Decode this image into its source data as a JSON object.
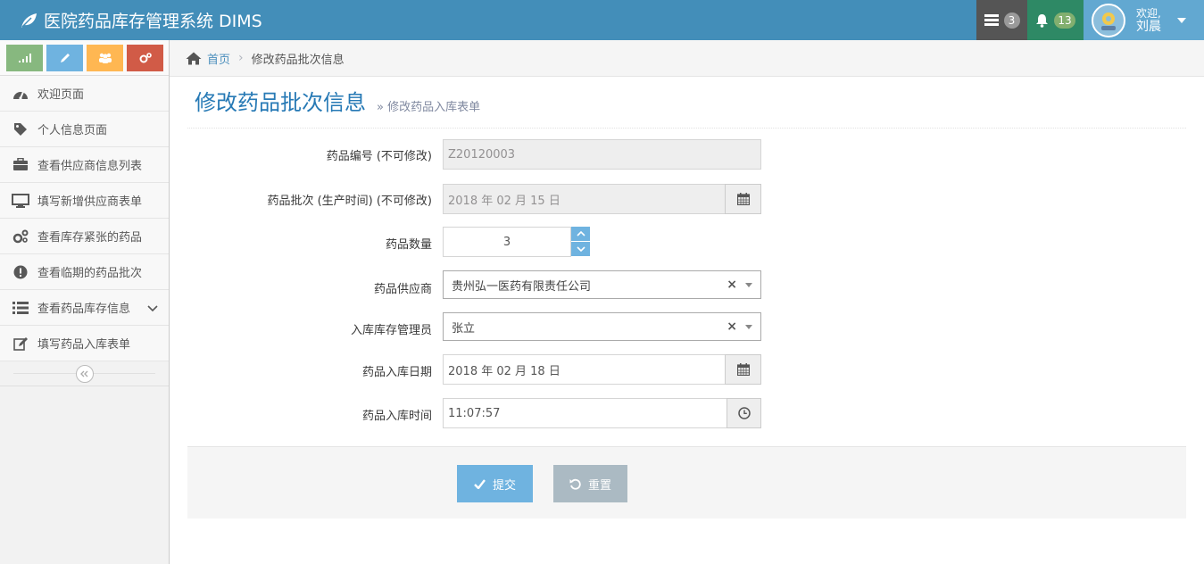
{
  "app": {
    "title": "医院药品库存管理系统 DIMS"
  },
  "navbar": {
    "tasks_count": "3",
    "notifications_count": "13",
    "user": {
      "greeting": "欢迎,",
      "name": "刘晨"
    }
  },
  "sidebar": {
    "shortcuts": [
      {
        "icon": "signal-icon",
        "color": "#87b87f"
      },
      {
        "icon": "pencil-icon",
        "color": "#6fb3e0"
      },
      {
        "icon": "users-icon",
        "color": "#ffb752"
      },
      {
        "icon": "cogs-icon",
        "color": "#d15b47"
      }
    ],
    "items": [
      {
        "label": "欢迎页面",
        "icon": "dashboard-icon"
      },
      {
        "label": "个人信息页面",
        "icon": "tag-icon"
      },
      {
        "label": "查看供应商信息列表",
        "icon": "briefcase-icon"
      },
      {
        "label": "填写新增供应商表单",
        "icon": "desktop-icon"
      },
      {
        "label": "查看库存紧张的药品",
        "icon": "cogs-icon"
      },
      {
        "label": "查看临期的药品批次",
        "icon": "exclamation-circle-icon"
      },
      {
        "label": "查看药品库存信息",
        "icon": "list-icon"
      },
      {
        "label": "填写药品入库表单",
        "icon": "edit-icon"
      }
    ]
  },
  "breadcrumb": {
    "home": "首页",
    "current": "修改药品批次信息"
  },
  "page": {
    "title": "修改药品批次信息",
    "subtitle": "修改药品入库表单"
  },
  "form": {
    "drug_id": {
      "label": "药品编号 (不可修改)",
      "value": "Z20120003"
    },
    "batch": {
      "label": "药品批次 (生产时间) (不可修改)",
      "value": "2018 年 02 月 15 日"
    },
    "quantity": {
      "label": "药品数量",
      "value": "3"
    },
    "supplier": {
      "label": "药品供应商",
      "value": "贵州弘一医药有限责任公司"
    },
    "manager": {
      "label": "入库库存管理员",
      "value": "张立"
    },
    "in_date": {
      "label": "药品入库日期",
      "value": "2018 年 02 月 18 日"
    },
    "in_time": {
      "label": "药品入库时间",
      "value": "11:07:57"
    }
  },
  "actions": {
    "submit": "提交",
    "reset": "重置"
  }
}
